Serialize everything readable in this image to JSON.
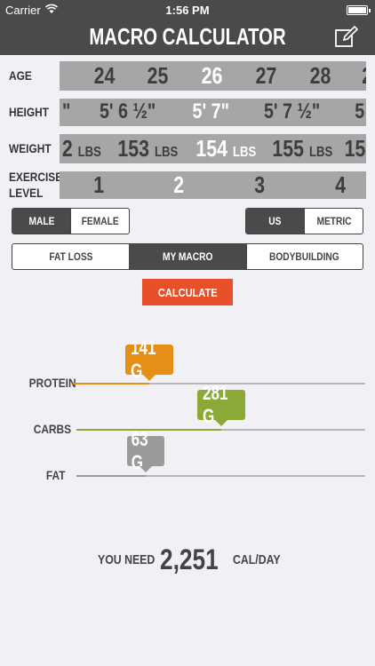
{
  "status_bar": {
    "carrier": "Carrier",
    "time": "1:56 PM"
  },
  "header": {
    "title": "MACRO CALCULATOR",
    "edit_icon": "edit-icon"
  },
  "pickers": {
    "age": {
      "label": "AGE",
      "values": [
        "24",
        "25",
        "26",
        "27",
        "28",
        "2"
      ],
      "selected": "26"
    },
    "height": {
      "label": "HEIGHT",
      "values": [
        "\"",
        "5' 6 ½\"",
        "5' 7\"",
        "5' 7 ½\"",
        "5"
      ],
      "selected": "5' 7\""
    },
    "weight": {
      "label": "WEIGHT",
      "unit": "LBS",
      "values": [
        "2",
        "153",
        "154",
        "155",
        "15"
      ],
      "selected": "154"
    },
    "exercise": {
      "label_line1": "EXERCISE",
      "label_line2": "LEVEL",
      "values": [
        "1",
        "2",
        "3",
        "4"
      ],
      "selected": "2"
    }
  },
  "gender": {
    "options": [
      "MALE",
      "FEMALE"
    ],
    "selected": "MALE"
  },
  "units": {
    "options": [
      "US",
      "METRIC"
    ],
    "selected": "US"
  },
  "goal": {
    "options": [
      "FAT LOSS",
      "MY MACRO",
      "BODYBUILDING"
    ],
    "selected": "MY MACRO"
  },
  "calculate_label": "CALCULATE",
  "macros": [
    {
      "label": "PROTEIN",
      "value": "141 G",
      "grams": 141,
      "fraction": 0.26,
      "color": "#e58f16"
    },
    {
      "label": "CARBS",
      "value": "281 G",
      "grams": 281,
      "fraction": 0.5,
      "color": "#8ba937"
    },
    {
      "label": "FAT",
      "value": "63 G",
      "grams": 63,
      "fraction": 0.24,
      "color": "#9a9a9a"
    }
  ],
  "result": {
    "prefix": "YOU NEED",
    "calories": "2,251",
    "suffix": "CAL/DAY"
  },
  "colors": {
    "header_bg": "#4a4a4a",
    "accent": "#e8502a",
    "strip_bg": "#a6a6a6",
    "page_bg": "#f1f0f5"
  }
}
